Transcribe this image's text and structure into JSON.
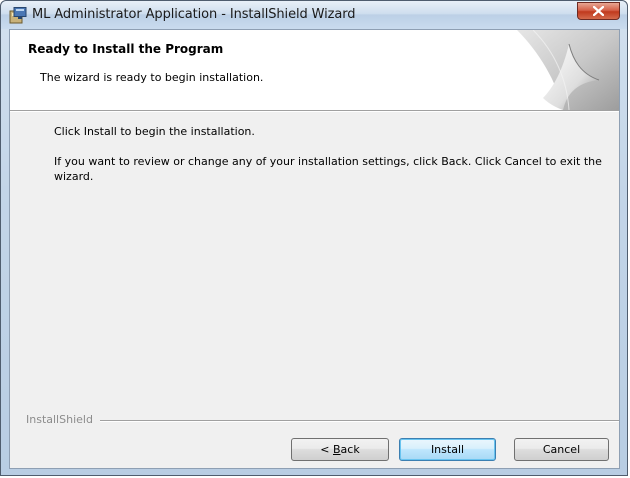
{
  "window": {
    "title": "ML Administrator Application - InstallShield Wizard",
    "icon": "installer-icon",
    "close_icon": "close-icon"
  },
  "header": {
    "title": "Ready to Install the Program",
    "subtitle": "The wizard is ready to begin installation.",
    "banner_icon": "page-curl-banner"
  },
  "body": {
    "line1": "Click Install to begin the installation.",
    "line2": "If you want to review or change any of your installation settings, click Back. Click Cancel to exit the wizard."
  },
  "footer": {
    "brand": "InstallShield",
    "buttons": {
      "back_prefix": "< ",
      "back_mnemonic": "B",
      "back_rest": "ack",
      "install": "Install",
      "cancel": "Cancel"
    }
  },
  "colors": {
    "close_button": "#c9472b",
    "default_button_border": "#3c7fb1",
    "frame": "#c3d5e8"
  }
}
